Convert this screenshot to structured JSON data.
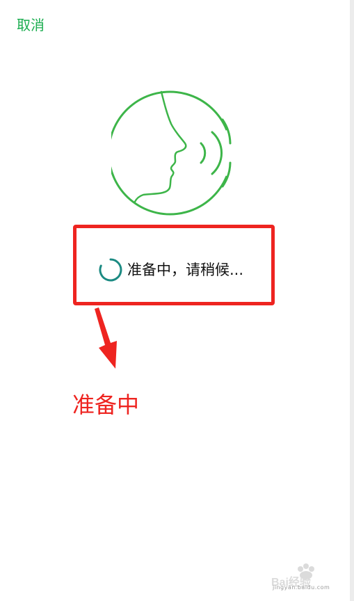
{
  "header": {
    "cancel_label": "取消"
  },
  "voice_icon": {
    "name": "face-speaking-icon",
    "color": "#3db549"
  },
  "status": {
    "spinner_icon": "loading-spinner-icon",
    "spinner_color": "#1b8a82",
    "text": "准备中，请稍候..."
  },
  "annotation": {
    "highlight_color": "#ee2420",
    "arrow_icon": "arrow-down-icon",
    "label": "准备中"
  },
  "watermark": {
    "logo": "Bai经验",
    "url": "jingyan.baidu.com"
  }
}
